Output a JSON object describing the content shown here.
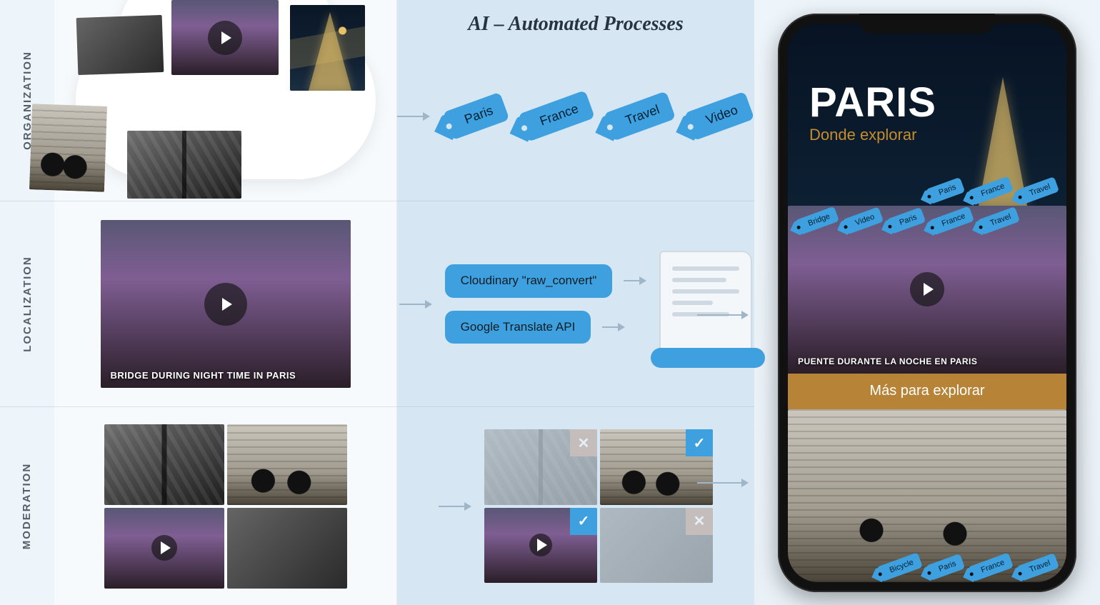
{
  "heading": "AI – Automated Processes",
  "rows": {
    "organization": {
      "label": "ORGANIZATION"
    },
    "localization": {
      "label": "LOCALIZATION"
    },
    "moderation": {
      "label": "MODERATION"
    }
  },
  "tags_organization": [
    "Paris",
    "France",
    "Travel",
    "Video"
  ],
  "video_caption_en": "BRIDGE DURING NIGHT TIME IN PARIS",
  "process_boxes": {
    "cloudinary": "Cloudinary \"raw_convert\"",
    "google": "Google Translate API"
  },
  "phone": {
    "hero_title": "PARIS",
    "hero_sub": "Donde explorar",
    "hero_tags": [
      "Paris",
      "France",
      "Travel"
    ],
    "video_tags": [
      "Bridge",
      "Video",
      "Paris",
      "France",
      "Travel"
    ],
    "video_caption_es": "PUENTE DURANTE LA NOCHE EN PARIS",
    "more_bar": "Más para explorar",
    "bike_tags": [
      "Bicycle",
      "Paris",
      "France",
      "Travel"
    ]
  },
  "moderation_marks": [
    "no",
    "ok",
    "ok",
    "no"
  ]
}
